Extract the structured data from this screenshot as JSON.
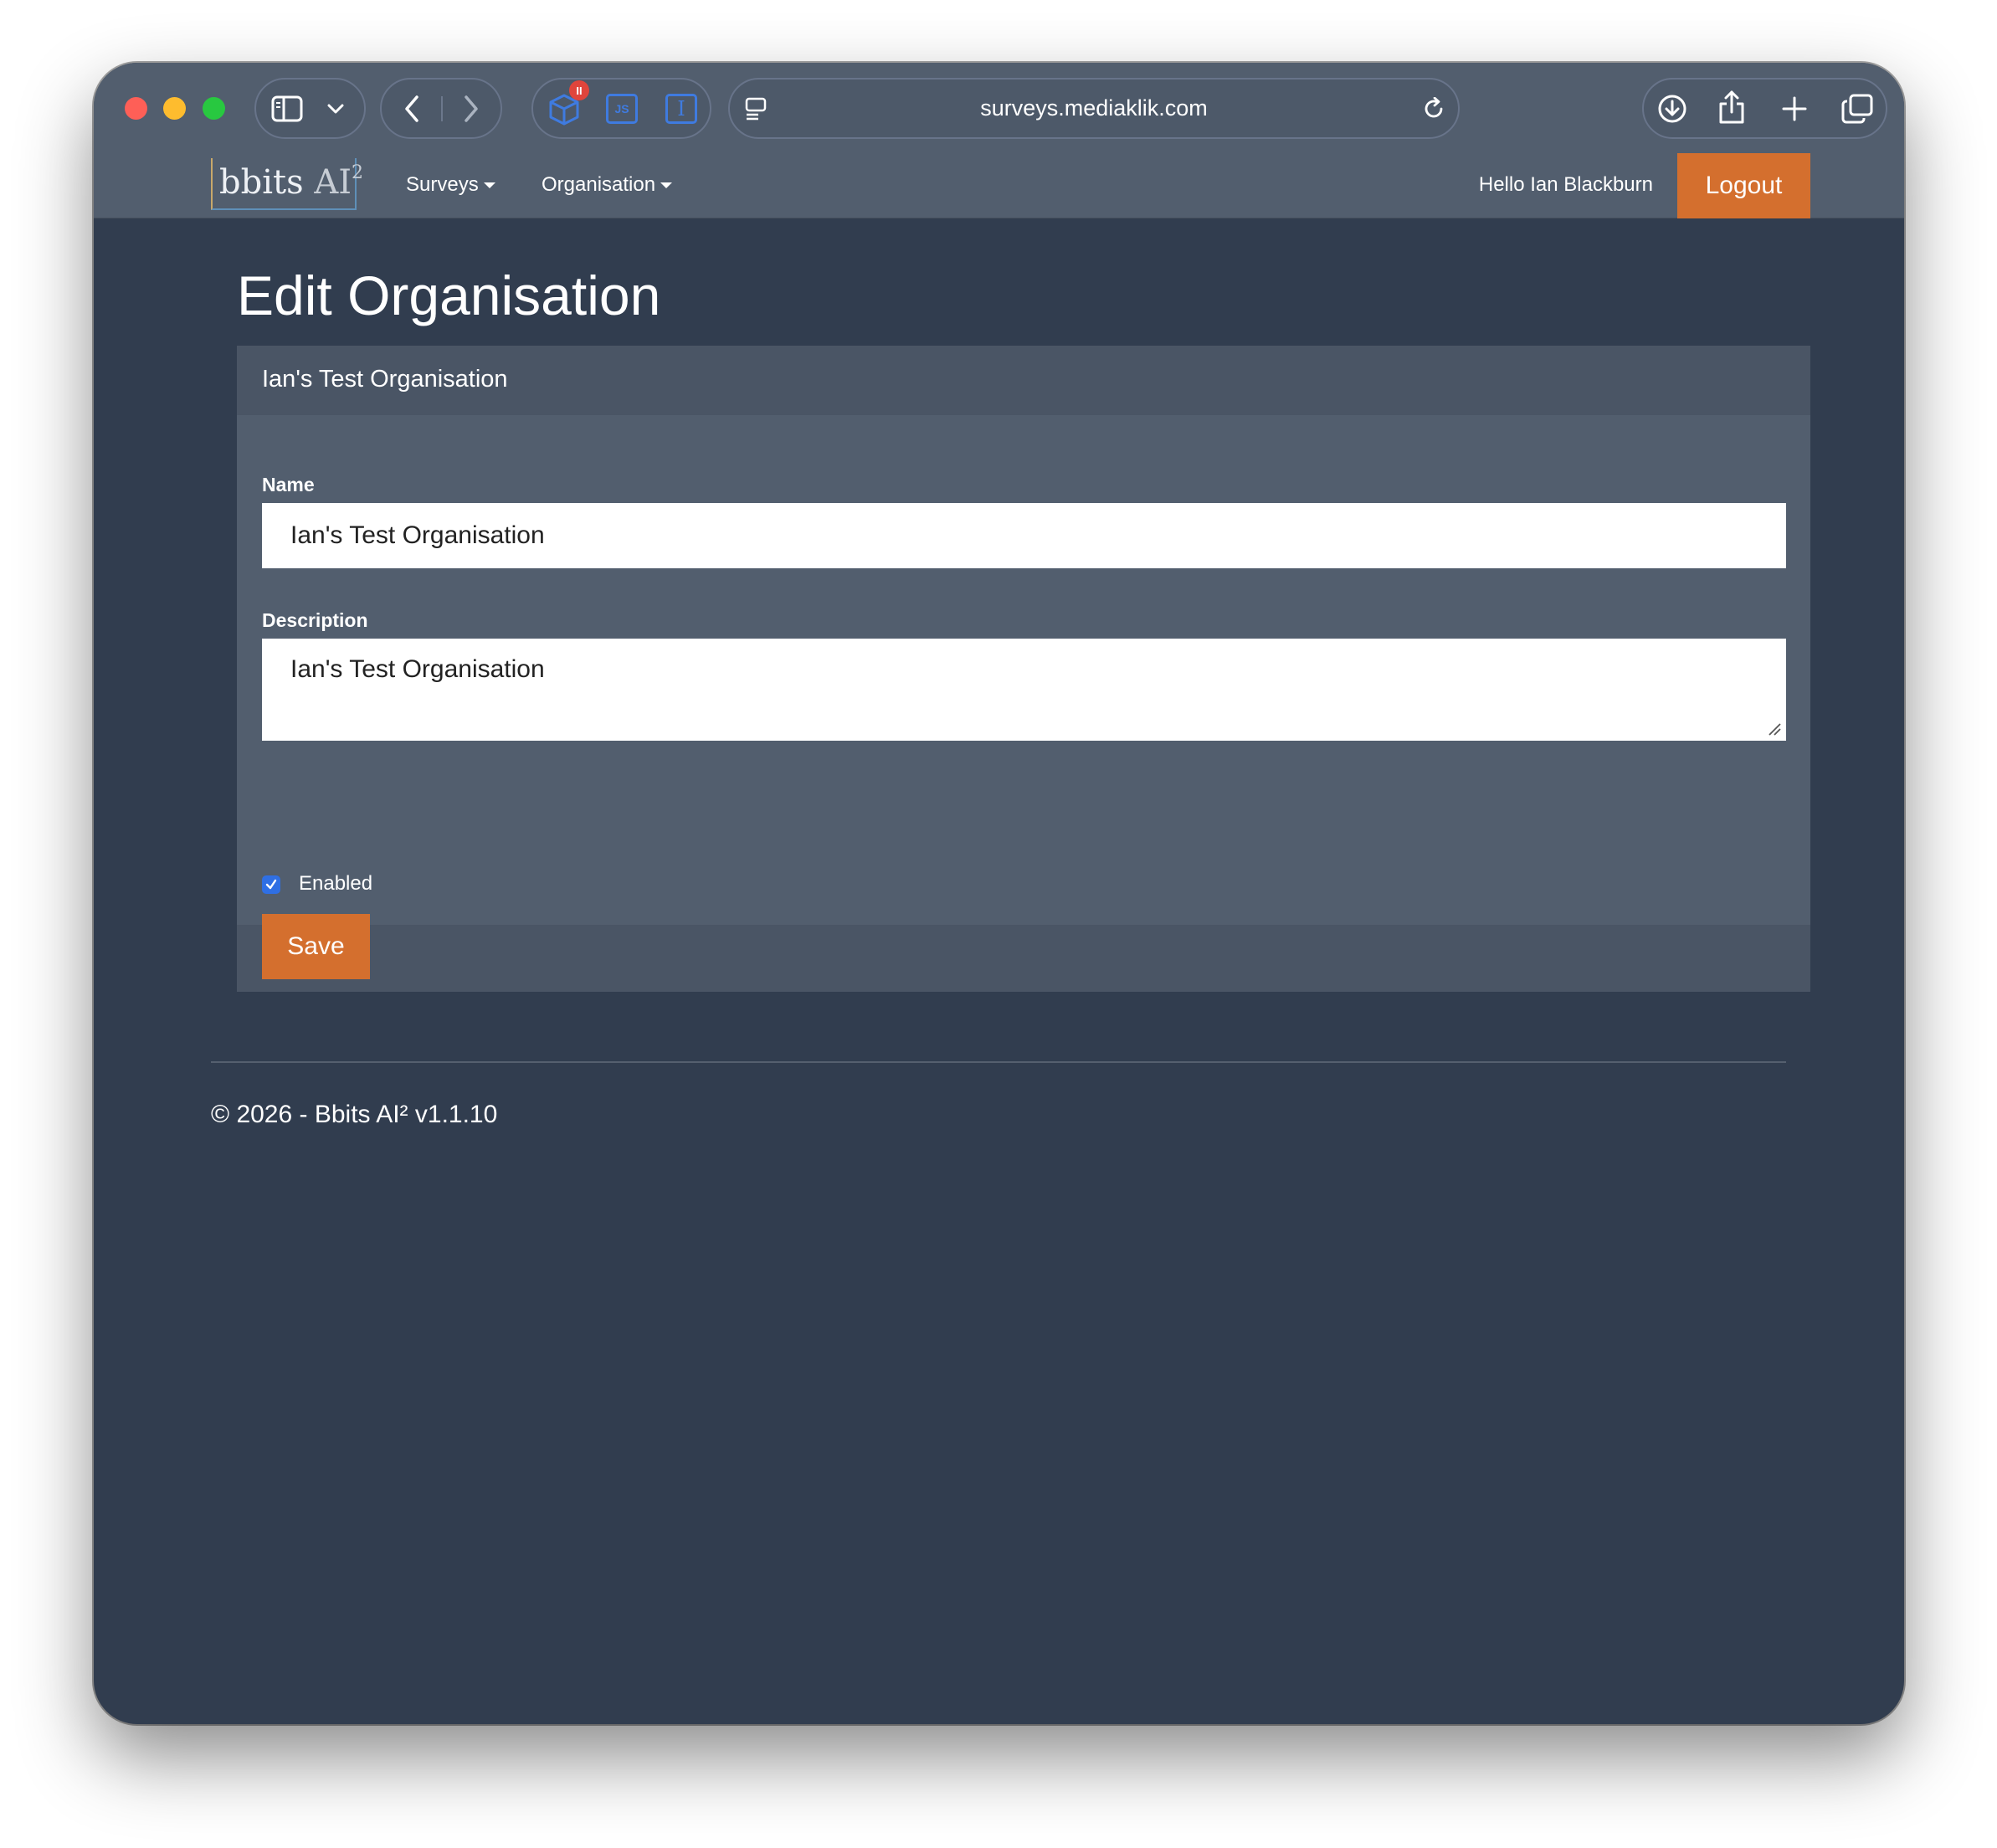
{
  "browser": {
    "url": "surveys.mediaklik.com",
    "extension_badge": "II",
    "js_extension_label": "JS",
    "text_extension_label": "I"
  },
  "navbar": {
    "logo_main": "bbits",
    "logo_ai": "AI",
    "logo_sup": "2",
    "menu_surveys": "Surveys",
    "menu_organisation": "Organisation",
    "greeting": "Hello Ian Blackburn",
    "logout_label": "Logout"
  },
  "page": {
    "title": "Edit Organisation"
  },
  "form": {
    "card_header": "Ian's Test Organisation",
    "name_label": "Name",
    "name_value": "Ian's Test Organisation",
    "description_label": "Description",
    "description_value": "Ian's Test Organisation",
    "enabled_label": "Enabled",
    "enabled_checked": true,
    "save_label": "Save"
  },
  "footer": {
    "text": "© 2026 - Bbits AI² v1.1.10"
  },
  "colors": {
    "accent": "#d46f2e",
    "page_bg": "#313d4f",
    "nav_bg": "#525e6e",
    "checkbox": "#2f6fe4"
  }
}
